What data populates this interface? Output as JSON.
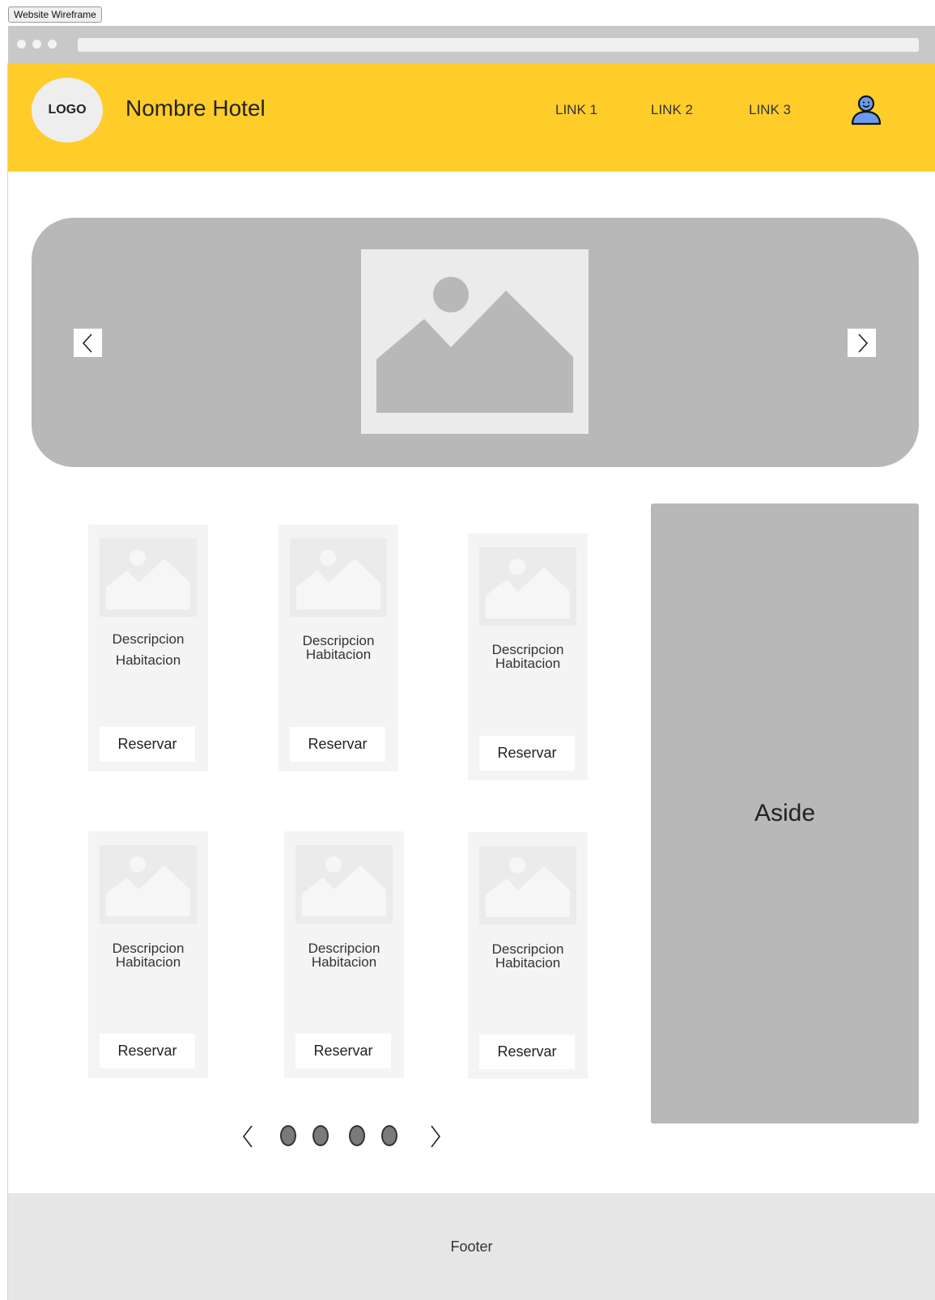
{
  "frame_label": "Website Wireframe",
  "header": {
    "logo_text": "LOGO",
    "title": "Nombre Hotel",
    "links": [
      "LINK 1",
      "LINK 2",
      "LINK 3"
    ],
    "user_icon": "user-icon",
    "background_color": "#fecd2a"
  },
  "carousel": {
    "prev_icon": "chevron-left-icon",
    "next_icon": "chevron-right-icon",
    "image_icon": "image-placeholder-icon"
  },
  "rooms": [
    {
      "description": "Descripcion Habitacion",
      "button_label": "Reservar"
    },
    {
      "description": "Descripcion Habitacion",
      "button_label": "Reservar"
    },
    {
      "description": "Descripcion Habitacion",
      "button_label": "Reservar"
    },
    {
      "description": "Descripcion Habitacion",
      "button_label": "Reservar"
    },
    {
      "description": "Descripcion Habitacion",
      "button_label": "Reservar"
    },
    {
      "description": "Descripcion Habitacion",
      "button_label": "Reservar"
    }
  ],
  "aside": {
    "label": "Aside"
  },
  "pagination": {
    "page_count": 4,
    "prev_icon": "chevron-left-icon",
    "next_icon": "chevron-right-icon"
  },
  "footer": {
    "label": "Footer"
  }
}
